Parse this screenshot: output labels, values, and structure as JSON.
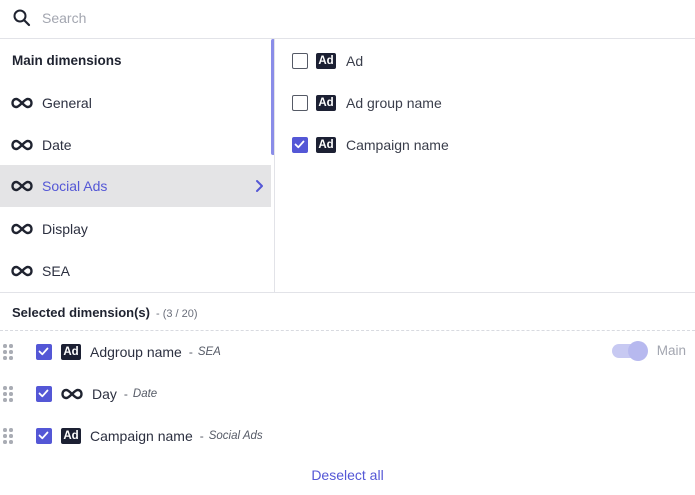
{
  "search": {
    "placeholder": "Search",
    "value": ""
  },
  "categories": {
    "heading": "Main dimensions",
    "items": [
      {
        "label": "General",
        "icon": "infinity-icon"
      },
      {
        "label": "Date",
        "icon": "infinity-icon"
      },
      {
        "label": "Social Ads",
        "icon": "infinity-icon",
        "active": true
      },
      {
        "label": "Display",
        "icon": "infinity-icon"
      },
      {
        "label": "SEA",
        "icon": "infinity-icon"
      }
    ]
  },
  "options": {
    "items": [
      {
        "badge": "Ad",
        "label": "Ad",
        "checked": false
      },
      {
        "badge": "Ad",
        "label": "Ad group name",
        "checked": false
      },
      {
        "badge": "Ad",
        "label": "Campaign name",
        "checked": true
      }
    ]
  },
  "selected": {
    "title": "Selected dimension(s)",
    "count": "- (3 / 20)",
    "rows": [
      {
        "badge": "Ad",
        "label": "Adgroup name",
        "separator": "-",
        "category": "SEA",
        "checked": true,
        "main_toggle": "Main"
      },
      {
        "icon": "infinity-icon",
        "label": "Day",
        "separator": "-",
        "category": "Date",
        "checked": true
      },
      {
        "badge": "Ad",
        "label": "Campaign name",
        "separator": "-",
        "category": "Social Ads",
        "checked": true
      }
    ],
    "deselect_all": "Deselect all"
  },
  "colors": {
    "accent": "#5457d6",
    "active_row_bg": "#e4e4e6",
    "badge_bg": "#1c2033"
  }
}
